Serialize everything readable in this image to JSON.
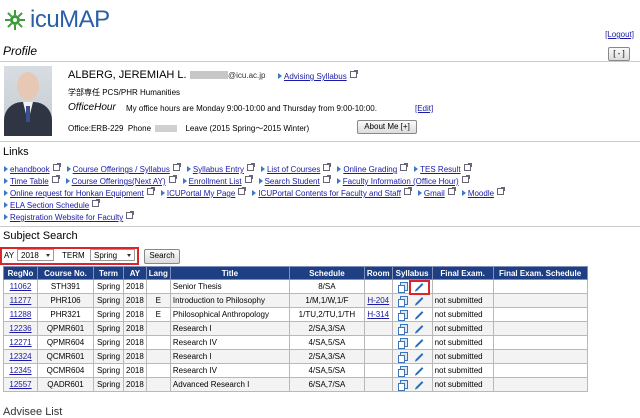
{
  "header": {
    "logo_text": "icuMAP",
    "logout": "[Logout]",
    "section_title": "Profile",
    "collapse_btn": "[ - ]"
  },
  "profile": {
    "name": "ALBERG, JEREMIAH L.",
    "email_domain": "@icu.ac.jp",
    "advising_syllabus": "Advising Syllabus",
    "department": "学部専任 PCS/PHR Humanities",
    "office_hour_label": "OfficeHour",
    "office_hour_text": "My office hours are Monday 9:00-10:00 and Thursday from 9:00-10:00.",
    "edit": "[Edit]",
    "office": "Office:ERB-229",
    "phone_label": "Phone",
    "phone": "",
    "leave": "Leave (2015 Spring～2015 Winter)",
    "about_btn": "About Me [+]"
  },
  "links": {
    "title": "Links",
    "rows": [
      [
        "ehandbook",
        "Course Offerings / Syllabus",
        "Syllabus Entry",
        "List of Courses",
        "Online Grading",
        "TES Result"
      ],
      [
        "Time Table",
        "Course Offerings(Next AY)",
        "Enrollment List",
        "Search Student",
        "Faculty Information (Office Hour)"
      ],
      [
        "Online request for Honkan Equipment",
        "ICUPortal My Page",
        "ICUPortal Contents for Faculty and Staff",
        "Gmail",
        "Moodle"
      ],
      [
        "ELA Section Schedule"
      ],
      [
        "Registration Website for Faculty"
      ]
    ]
  },
  "search": {
    "title": "Subject Search",
    "ay_label": "AY",
    "ay_value": "2018",
    "term_label": "TERM",
    "term_value": "Spring",
    "button": "Search"
  },
  "table": {
    "headers": [
      "RegNo",
      "Course No.",
      "Term",
      "AY",
      "Lang",
      "Title",
      "Schedule",
      "Room",
      "Syllabus",
      "Final Exam.",
      "Final Exam. Schedule"
    ],
    "rows": [
      {
        "regno": "11062",
        "course": "STH391",
        "term": "Spring",
        "ay": "2018",
        "lang": "",
        "title": "Senior Thesis",
        "schedule": "8/SA",
        "room": "",
        "final": "",
        "final_sched": ""
      },
      {
        "regno": "11277",
        "course": "PHR106",
        "term": "Spring",
        "ay": "2018",
        "lang": "E",
        "title": "Introduction to Philosophy",
        "schedule": "1/M,1/W,1/F",
        "room": "H-204",
        "final": "not submitted",
        "final_sched": ""
      },
      {
        "regno": "11288",
        "course": "PHR321",
        "term": "Spring",
        "ay": "2018",
        "lang": "E",
        "title": "Philosophical Anthropology",
        "schedule": "1/TU,2/TU,1/TH",
        "room": "H-314",
        "final": "not submitted",
        "final_sched": ""
      },
      {
        "regno": "12236",
        "course": "QPMR601",
        "term": "Spring",
        "ay": "2018",
        "lang": "",
        "title": "Research I",
        "schedule": "2/SA,3/SA",
        "room": "",
        "final": "not submitted",
        "final_sched": ""
      },
      {
        "regno": "12271",
        "course": "QPMR604",
        "term": "Spring",
        "ay": "2018",
        "lang": "",
        "title": "Research IV",
        "schedule": "4/SA,5/SA",
        "room": "",
        "final": "not submitted",
        "final_sched": ""
      },
      {
        "regno": "12324",
        "course": "QCMR601",
        "term": "Spring",
        "ay": "2018",
        "lang": "",
        "title": "Research I",
        "schedule": "2/SA,3/SA",
        "room": "",
        "final": "not submitted",
        "final_sched": ""
      },
      {
        "regno": "12345",
        "course": "QCMR604",
        "term": "Spring",
        "ay": "2018",
        "lang": "",
        "title": "Research IV",
        "schedule": "4/SA,5/SA",
        "room": "",
        "final": "not submitted",
        "final_sched": ""
      },
      {
        "regno": "12557",
        "course": "QADR601",
        "term": "Spring",
        "ay": "2018",
        "lang": "",
        "title": "Advanced Research I",
        "schedule": "6/SA,7/SA",
        "room": "",
        "final": "not submitted",
        "final_sched": ""
      }
    ]
  },
  "footer": {
    "advisee_title": "Advisee List"
  },
  "colors": {
    "table_header": "#1f3f84",
    "link": "#1a1aa6",
    "highlight": "#d9262b",
    "logo": "#2a5fa8"
  }
}
